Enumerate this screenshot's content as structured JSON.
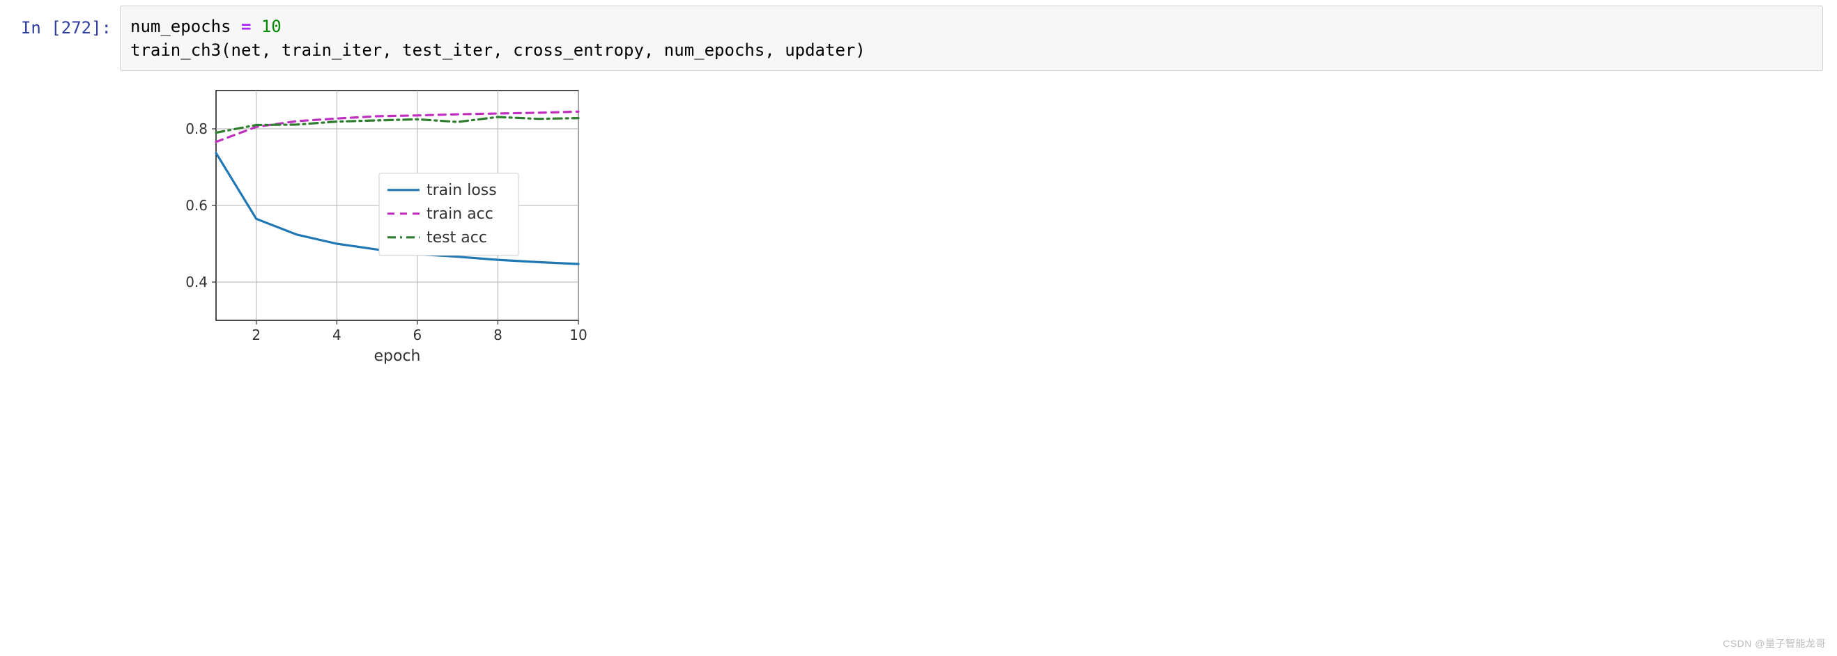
{
  "cell": {
    "prompt": "In [272]:",
    "code": {
      "line1_var": "num_epochs",
      "line1_op": "=",
      "line1_val": "10",
      "line2": "train_ch3(net, train_iter, test_iter, cross_entropy, num_epochs, updater)"
    }
  },
  "chart_data": {
    "type": "line",
    "xlabel": "epoch",
    "ylabel": "",
    "xlim": [
      1,
      10
    ],
    "ylim": [
      0.3,
      0.9
    ],
    "xticks": [
      2,
      4,
      6,
      8,
      10
    ],
    "yticks": [
      0.4,
      0.6,
      0.8
    ],
    "x": [
      1,
      2,
      3,
      4,
      5,
      6,
      7,
      8,
      9,
      10
    ],
    "series": [
      {
        "name": "train loss",
        "color": "#1f77b4",
        "dash": "solid",
        "values": [
          0.737,
          0.565,
          0.524,
          0.5,
          0.485,
          0.473,
          0.466,
          0.458,
          0.452,
          0.447
        ]
      },
      {
        "name": "train acc",
        "color": "#c030c0",
        "dash": "dashed",
        "values": [
          0.766,
          0.805,
          0.82,
          0.827,
          0.833,
          0.835,
          0.838,
          0.84,
          0.842,
          0.845
        ]
      },
      {
        "name": "test acc",
        "color": "#2f7d2f",
        "dash": "dashdot",
        "values": [
          0.79,
          0.81,
          0.811,
          0.819,
          0.822,
          0.825,
          0.818,
          0.831,
          0.826,
          0.828
        ]
      }
    ],
    "legend": {
      "position": "center-right",
      "items": [
        "train loss",
        "train acc",
        "test acc"
      ]
    }
  },
  "watermark": "CSDN @量子智能龙哥"
}
